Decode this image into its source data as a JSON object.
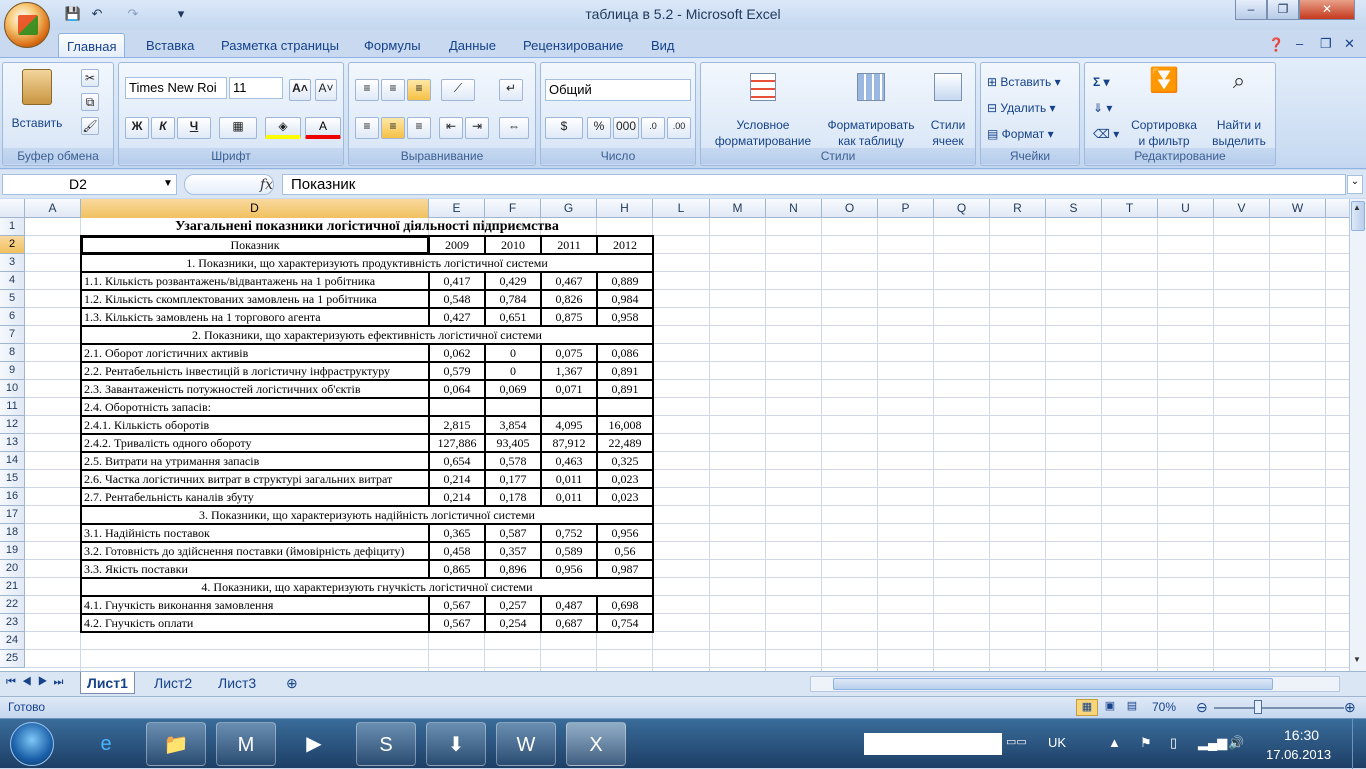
{
  "window": {
    "title": "таблица в 5.2 - Microsoft Excel"
  },
  "qat": {
    "save": "💾",
    "undo": "↶",
    "redo": "↷",
    "customize": "▾"
  },
  "ribbon_tabs": [
    "Главная",
    "Вставка",
    "Разметка страницы",
    "Формулы",
    "Данные",
    "Рецензирование",
    "Вид"
  ],
  "clipboard": {
    "paste": "Вставить",
    "label": "Буфер обмена"
  },
  "font": {
    "name": "Times New Roi",
    "size": "11",
    "bold": "Ж",
    "italic": "К",
    "underline": "Ч",
    "label": "Шрифт"
  },
  "alignment": {
    "label": "Выравнивание"
  },
  "number": {
    "format": "Общий",
    "percent": "%",
    "thousands": "000",
    "label": "Число"
  },
  "styles": {
    "conditional": "Условное",
    "conditional2": "форматирование",
    "format_table": "Форматировать",
    "format_table2": "как таблицу",
    "cell_styles": "Стили",
    "cell_styles2": "ячеек",
    "label": "Стили"
  },
  "cells": {
    "insert": "Вставить",
    "delete": "Удалить",
    "format": "Формат",
    "label": "Ячейки"
  },
  "editing": {
    "sort": "Сортировка",
    "sort2": "и фильтр",
    "find": "Найти и",
    "find2": "выделить",
    "label": "Редактирование"
  },
  "formula_bar": {
    "name_box": "D2",
    "fx": "fx",
    "content": "Показник"
  },
  "columns": [
    "A",
    "D",
    "E",
    "F",
    "G",
    "H",
    "L",
    "M",
    "N",
    "O",
    "P",
    "Q",
    "R",
    "S",
    "T",
    "U",
    "V",
    "W"
  ],
  "rows": [
    "1",
    "2",
    "3",
    "4",
    "5",
    "6",
    "7",
    "8",
    "9",
    "10",
    "11",
    "12",
    "13",
    "14",
    "15",
    "16",
    "17",
    "18",
    "19",
    "20",
    "21",
    "22",
    "23",
    "24",
    "25"
  ],
  "sheet": {
    "title": "Узагальнені показники логістичної діяльності підприємства",
    "header": {
      "label": "Показник",
      "years": [
        "2009",
        "2010",
        "2011",
        "2012"
      ]
    },
    "body": [
      {
        "section": "1. Показники, що характеризують продуктивність логістичної системи"
      },
      {
        "label": "1.1. Кількість розвантажень/відвантажень на 1 робітника",
        "v": [
          "0,417",
          "0,429",
          "0,467",
          "0,889"
        ]
      },
      {
        "label": "1.2. Кількість скомплектованих замовлень на 1 робітника",
        "v": [
          "0,548",
          "0,784",
          "0,826",
          "0,984"
        ]
      },
      {
        "label": "1.3. Кількість замовлень на 1 торгового агента",
        "v": [
          "0,427",
          "0,651",
          "0,875",
          "0,958"
        ]
      },
      {
        "section": "2. Показники, що характеризують ефективність логістичної системи"
      },
      {
        "label": "2.1. Оборот логістичних активів",
        "v": [
          "0,062",
          "0",
          "0,075",
          "0,086"
        ]
      },
      {
        "label": "2.2. Рентабельність інвестицій в логістичну інфраструктуру",
        "v": [
          "0,579",
          "0",
          "1,367",
          "0,891"
        ]
      },
      {
        "label": "2.3. Завантаженість потужностей логістичних об'єктів",
        "v": [
          "0,064",
          "0,069",
          "0,071",
          "0,891"
        ]
      },
      {
        "label": "2.4. Оборотність запасів:",
        "v": [
          "",
          "",
          "",
          ""
        ]
      },
      {
        "label": "2.4.1. Кількість оборотів",
        "v": [
          "2,815",
          "3,854",
          "4,095",
          "16,008"
        ]
      },
      {
        "label": "2.4.2. Тривалість одного обороту",
        "v": [
          "127,886",
          "93,405",
          "87,912",
          "22,489"
        ]
      },
      {
        "label": "2.5. Витрати на утримання запасів",
        "v": [
          "0,654",
          "0,578",
          "0,463",
          "0,325"
        ]
      },
      {
        "label": "2.6. Частка логістичних витрат в структурі загальних витрат",
        "v": [
          "0,214",
          "0,177",
          "0,011",
          "0,023"
        ]
      },
      {
        "label": "2.7. Рентабельність каналів збуту",
        "v": [
          "0,214",
          "0,178",
          "0,011",
          "0,023"
        ]
      },
      {
        "section": "3. Показники, що характеризують надійність логістичної системи"
      },
      {
        "label": "3.1. Надійність поставок",
        "v": [
          "0,365",
          "0,587",
          "0,752",
          "0,956"
        ]
      },
      {
        "label": "3.2. Готовність до здійснення поставки (ймовірність дефіциту)",
        "v": [
          "0,458",
          "0,357",
          "0,589",
          "0,56"
        ]
      },
      {
        "label": "3.3. Якість поставки",
        "v": [
          "0,865",
          "0,896",
          "0,956",
          "0,987"
        ]
      },
      {
        "section": "4. Показники, що характеризують гнучкість логістичної системи"
      },
      {
        "label": "4.1. Гнучкість виконання замовлення",
        "v": [
          "0,567",
          "0,257",
          "0,487",
          "0,698"
        ]
      },
      {
        "label": "4.2. Гнучкість оплати",
        "v": [
          "0,567",
          "0,254",
          "0,687",
          "0,754"
        ]
      }
    ]
  },
  "sheet_tabs": [
    "Лист1",
    "Лист2",
    "Лист3"
  ],
  "status": {
    "ready": "Готово",
    "zoom": "70%"
  },
  "tray": {
    "lang": "UK",
    "time": "16:30",
    "date": "17.06.2013"
  }
}
